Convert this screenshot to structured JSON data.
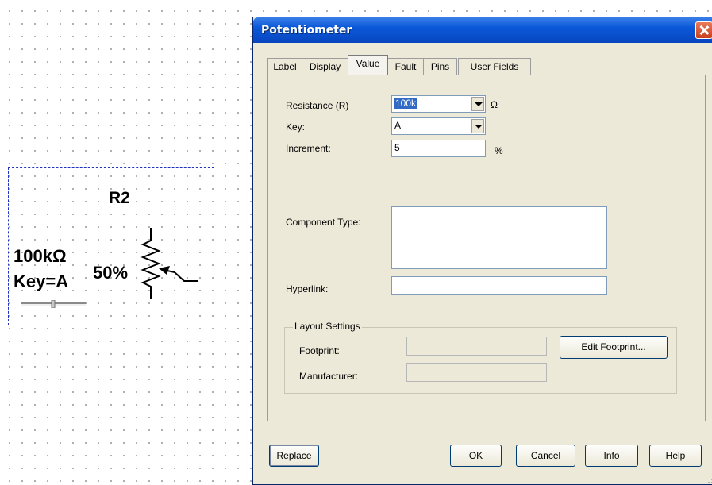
{
  "schematic": {
    "ref": "R2",
    "value": "100kΩ",
    "key": "Key=A",
    "percent": "50%",
    "slider_level": 0.5
  },
  "dialog": {
    "title": "Potentiometer",
    "tabs": [
      "Label",
      "Display",
      "Value",
      "Fault",
      "Pins",
      "User Fields"
    ],
    "active_tab": "Value",
    "resistance_label": "Resistance (R)",
    "resistance_value": "100k",
    "resistance_unit": "Ω",
    "key_label": "Key:",
    "key_value": "A",
    "increment_label": "Increment:",
    "increment_value": "5",
    "increment_unit": "%",
    "component_type_label": "Component Type:",
    "component_type_value": "",
    "hyperlink_label": "Hyperlink:",
    "hyperlink_value": "",
    "layout_group": "Layout Settings",
    "footprint_label": "Footprint:",
    "footprint_value": "",
    "manufacturer_label": "Manufacturer:",
    "manufacturer_value": "",
    "edit_footprint": "Edit Footprint...",
    "buttons": {
      "replace": "Replace",
      "ok": "OK",
      "cancel": "Cancel",
      "info": "Info",
      "help": "Help"
    }
  },
  "colors": {
    "selection_border": "#2233bb",
    "titlebar": "#0a58d8",
    "dialog_bg": "#ece9d8"
  }
}
